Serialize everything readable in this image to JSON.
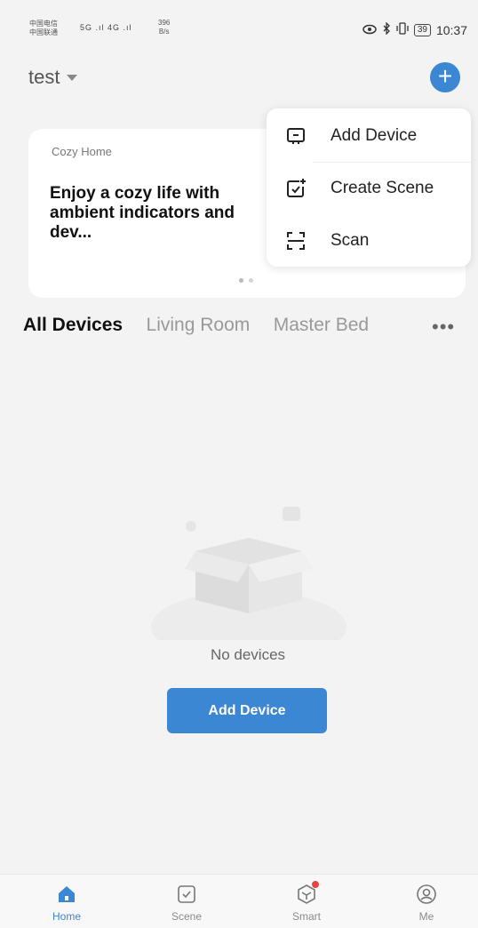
{
  "status_bar": {
    "carrier_line1": "中国电信",
    "carrier_line2": "中国联通",
    "signal_text": "5G  .ıl  4G  .ıl",
    "net_speed_value": "396",
    "net_speed_unit": "B/s",
    "battery": "39",
    "time": "10:37"
  },
  "header": {
    "home_name": "test"
  },
  "banner": {
    "kicker": "Cozy Home",
    "title": "Enjoy a cozy life with ambient indicators and dev..."
  },
  "menu": {
    "items": [
      {
        "label": "Add Device",
        "icon": "add-device-icon"
      },
      {
        "label": "Create Scene",
        "icon": "create-scene-icon"
      },
      {
        "label": "Scan",
        "icon": "scan-icon"
      }
    ]
  },
  "tabs": [
    {
      "label": "All Devices",
      "active": true
    },
    {
      "label": "Living Room",
      "active": false
    },
    {
      "label": "Master Bed",
      "active": false
    }
  ],
  "more_label": "•••",
  "empty_state": {
    "message": "No devices",
    "button_label": "Add Device"
  },
  "bottom_nav": [
    {
      "label": "Home",
      "icon": "home-icon",
      "active": true
    },
    {
      "label": "Scene",
      "icon": "scene-icon",
      "active": false
    },
    {
      "label": "Smart",
      "icon": "smart-icon",
      "active": false
    },
    {
      "label": "Me",
      "icon": "me-icon",
      "active": false
    }
  ],
  "colors": {
    "accent": "#3b87d3",
    "background": "#f3f3f3",
    "notification_dot": "#e5463f"
  }
}
